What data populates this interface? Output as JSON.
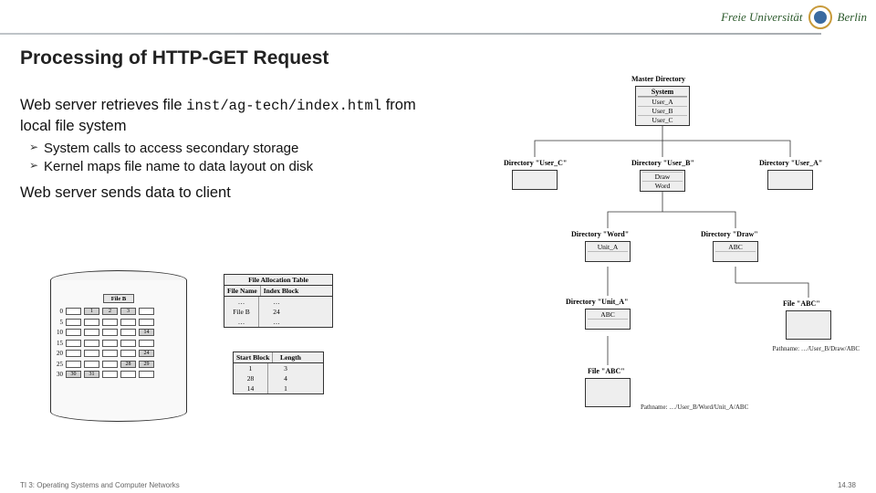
{
  "brand": {
    "name": "Freie Universität",
    "city": "Berlin"
  },
  "slide": {
    "title": "Processing of HTTP-GET Request",
    "body_pre": "Web server retrieves file ",
    "body_code": "inst/ag-tech/index.html",
    "body_post": " from local file system",
    "bullet1": "System calls to access secondary storage",
    "bullet2": "Kernel maps file name to data layout on disk",
    "body2": "Web server sends data to client"
  },
  "dir_diagram": {
    "master_label": "Master Directory",
    "master": {
      "hdr": "System",
      "r1": "User_A",
      "r2": "User_B",
      "r3": "User_C"
    },
    "userC": {
      "label": "Directory \"User_C\""
    },
    "userB": {
      "label": "Directory \"User_B\"",
      "r1": "Draw",
      "r2": "Word"
    },
    "userA": {
      "label": "Directory \"User_A\""
    },
    "word": {
      "label": "Directory \"Word\"",
      "r1": "Unit_A"
    },
    "draw": {
      "label": "Directory \"Draw\"",
      "r1": "ABC"
    },
    "unitA": {
      "label": "Directory \"Unit_A\"",
      "r1": "ABC"
    },
    "fileABC": {
      "label": "File \"ABC\""
    },
    "fileABC2": {
      "label": "File \"ABC\""
    },
    "path1": "Pathname: …/User_B/Draw/ABC",
    "path2": "Pathname: …/User_B/Word/Unit_A/ABC"
  },
  "disk_diagram": {
    "fileB_label": "File B",
    "fat": {
      "title": "File Allocation Table",
      "h1": "File Name",
      "h2": "Index Block",
      "r": [
        [
          "…",
          "…"
        ],
        [
          "File B",
          "24"
        ],
        [
          "…",
          "…"
        ]
      ]
    },
    "extent": {
      "h1": "Start Block",
      "h2": "Length",
      "r": [
        [
          "1",
          "3"
        ],
        [
          "28",
          "4"
        ],
        [
          "14",
          "1"
        ]
      ]
    },
    "cols_header": [
      "0",
      "5",
      "10",
      "15",
      "20",
      "25",
      "30"
    ]
  },
  "footer": {
    "left": "TI 3: Operating Systems and Computer Networks",
    "right": "14.38"
  }
}
